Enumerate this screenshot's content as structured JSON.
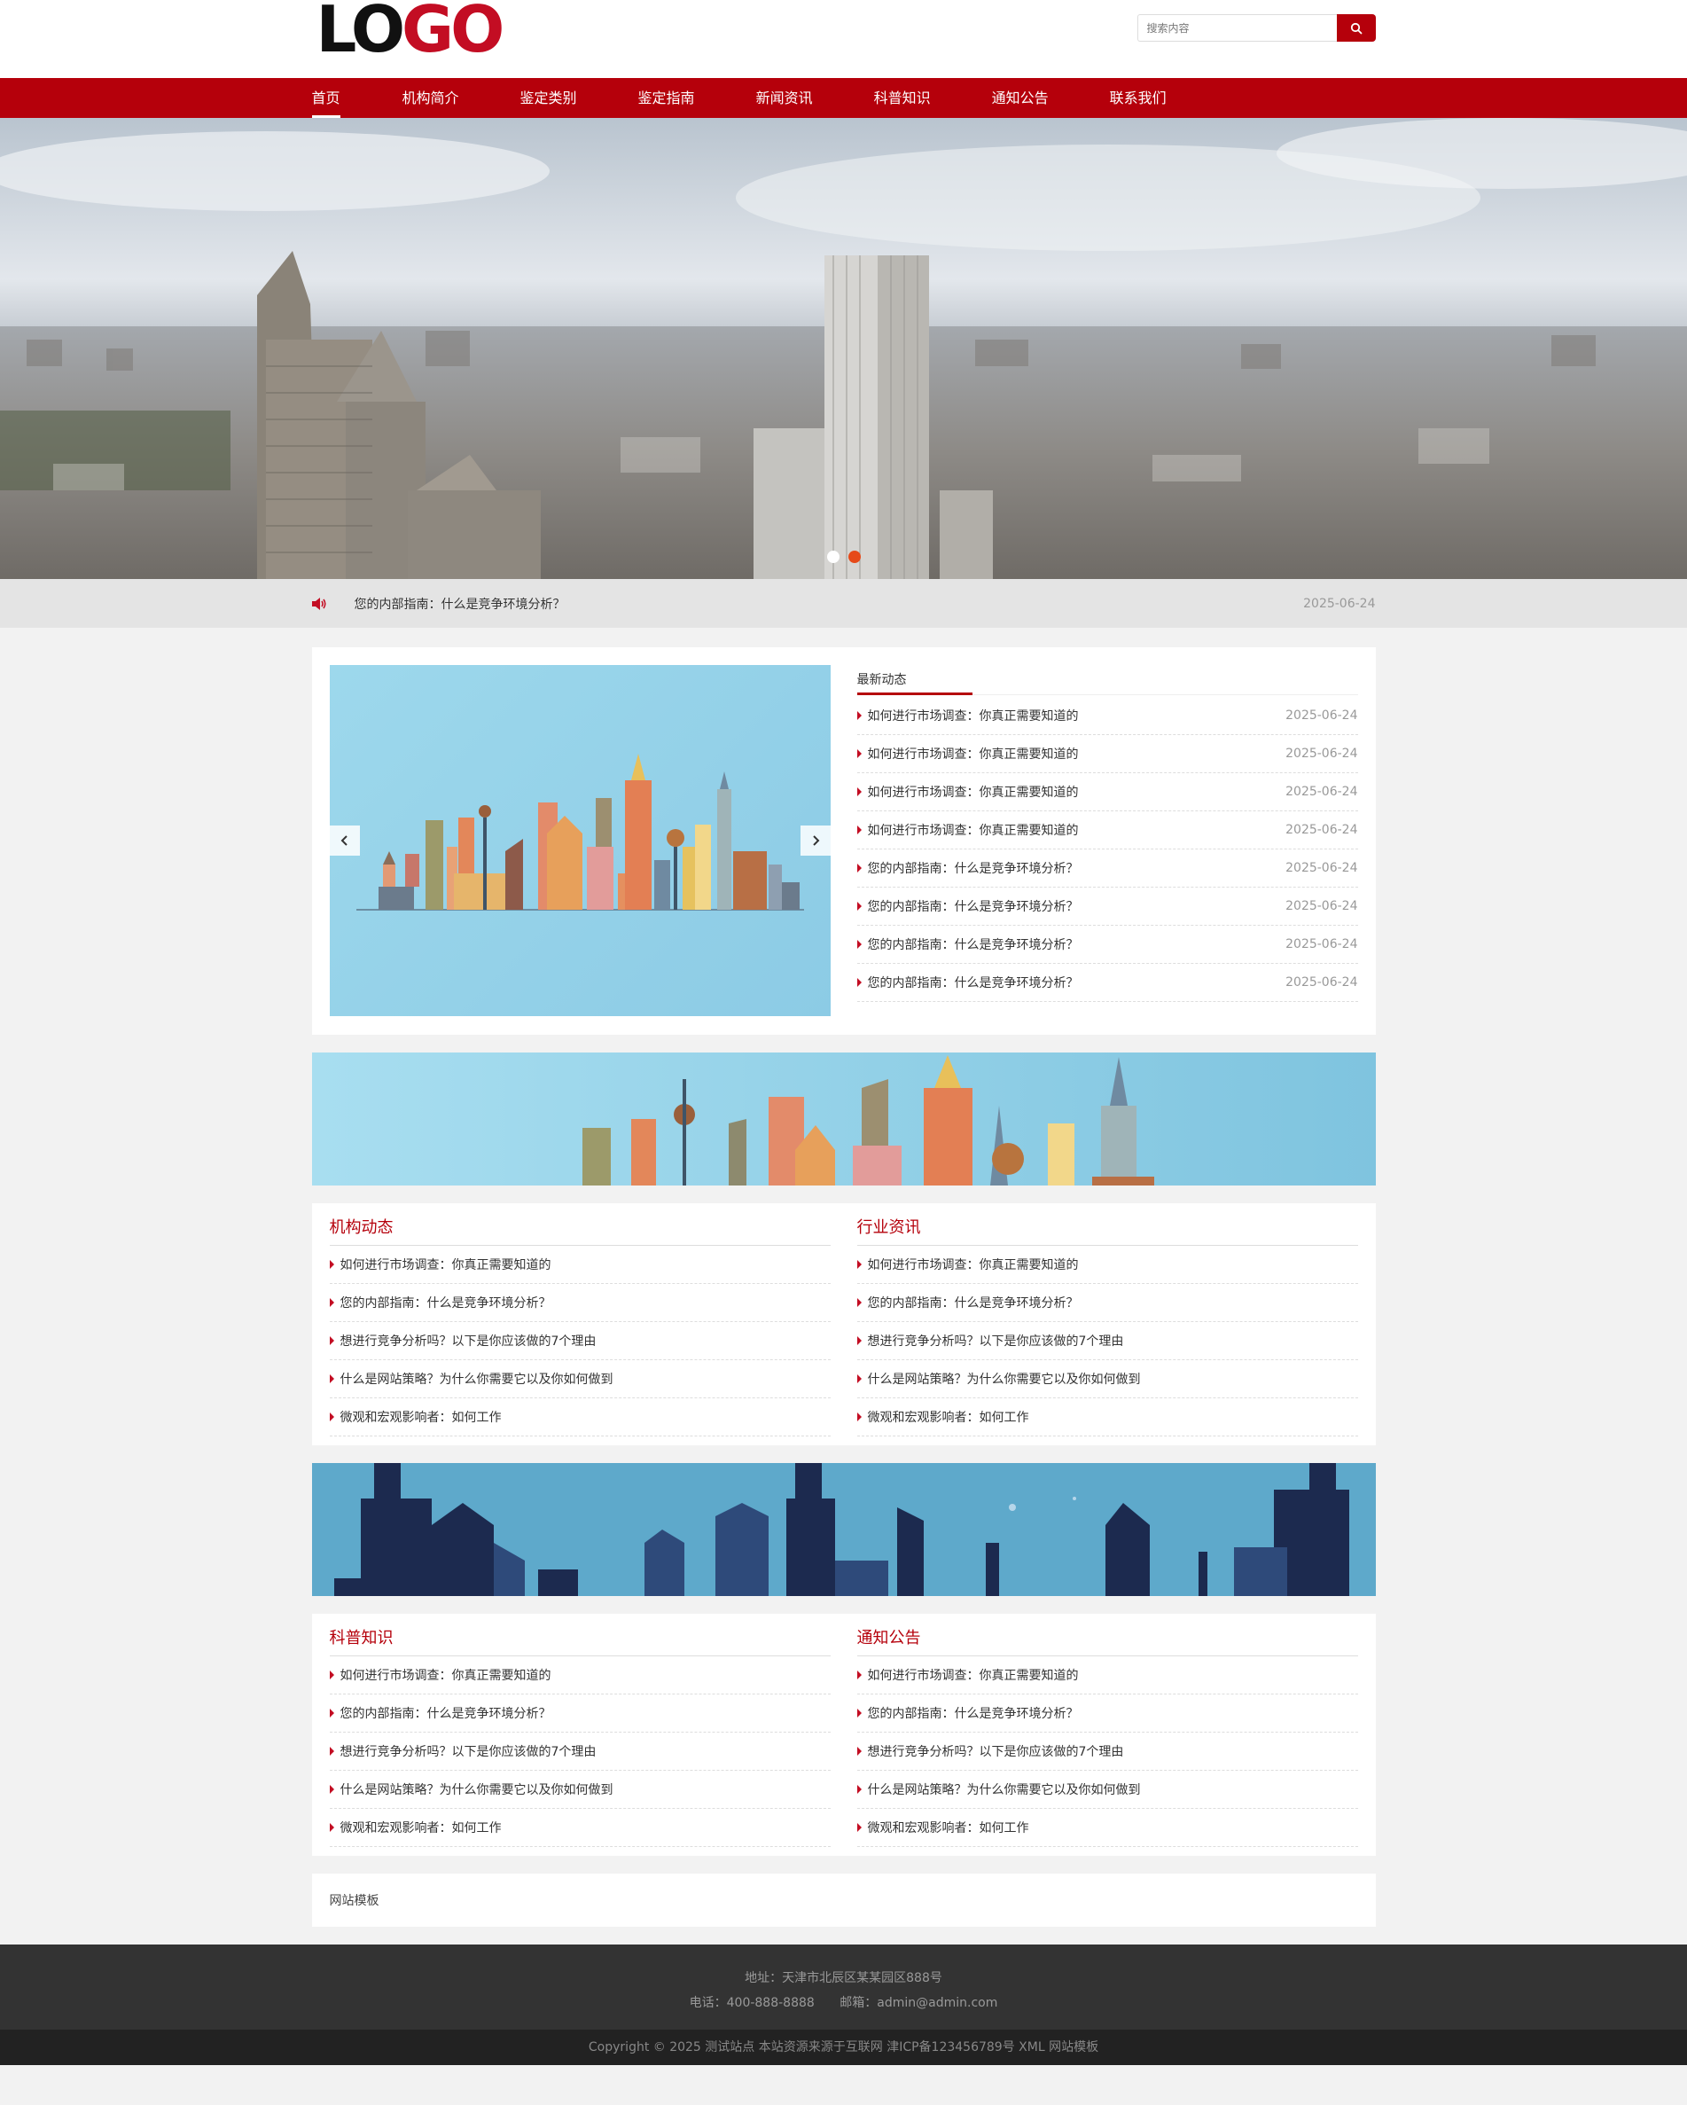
{
  "header": {
    "logo_text_left": "LO",
    "logo_text_right": "GO",
    "search_placeholder": "搜索内容",
    "search_icon": "search-icon"
  },
  "nav": {
    "items": [
      "首页",
      "机构简介",
      "鉴定类别",
      "鉴定指南",
      "新闻资讯",
      "科普知识",
      "通知公告",
      "联系我们"
    ],
    "active_index": 0
  },
  "banner": {
    "slide_count": 2,
    "active_slide": 1
  },
  "notice": {
    "icon": "speaker-icon",
    "text": "您的内部指南：什么是竞争环境分析？",
    "date": "2025-06-24"
  },
  "latest": {
    "title": "最新动态",
    "items": [
      {
        "title": "如何进行市场调查：你真正需要知道的",
        "date": "2025-06-24"
      },
      {
        "title": "如何进行市场调查：你真正需要知道的",
        "date": "2025-06-24"
      },
      {
        "title": "如何进行市场调查：你真正需要知道的",
        "date": "2025-06-24"
      },
      {
        "title": "如何进行市场调查：你真正需要知道的",
        "date": "2025-06-24"
      },
      {
        "title": "您的内部指南：什么是竞争环境分析？",
        "date": "2025-06-24"
      },
      {
        "title": "您的内部指南：什么是竞争环境分析？",
        "date": "2025-06-24"
      },
      {
        "title": "您的内部指南：什么是竞争环境分析？",
        "date": "2025-06-24"
      },
      {
        "title": "您的内部指南：什么是竞争环境分析？",
        "date": "2025-06-24"
      }
    ]
  },
  "sections": {
    "org_news": {
      "title": "机构动态",
      "items": [
        "如何进行市场调查：你真正需要知道的",
        "您的内部指南：什么是竞争环境分析？",
        "想进行竞争分析吗？以下是你应该做的7个理由",
        "什么是网站策略？为什么你需要它以及你如何做到",
        "微观和宏观影响者：如何工作"
      ]
    },
    "industry": {
      "title": "行业资讯",
      "items": [
        "如何进行市场调查：你真正需要知道的",
        "您的内部指南：什么是竞争环境分析？",
        "想进行竞争分析吗？以下是你应该做的7个理由",
        "什么是网站策略？为什么你需要它以及你如何做到",
        "微观和宏观影响者：如何工作"
      ]
    },
    "science": {
      "title": "科普知识",
      "items": [
        "如何进行市场调查：你真正需要知道的",
        "您的内部指南：什么是竞争环境分析？",
        "想进行竞争分析吗？以下是你应该做的7个理由",
        "什么是网站策略？为什么你需要它以及你如何做到",
        "微观和宏观影响者：如何工作"
      ]
    },
    "announce": {
      "title": "通知公告",
      "items": [
        "如何进行市场调查：你真正需要知道的",
        "您的内部指南：什么是竞争环境分析？",
        "想进行竞争分析吗？以下是你应该做的7个理由",
        "什么是网站策略？为什么你需要它以及你如何做到",
        "微观和宏观影响者：如何工作"
      ]
    }
  },
  "links": {
    "item": "网站模板"
  },
  "footer": {
    "address": "地址：天津市北辰区某某园区888号",
    "phone": "电话：400-888-8888",
    "email": "邮箱：admin@admin.com",
    "copyright": "Copyright © 2025 测试站点 本站资源来源于互联网 津ICP备123456789号 XML 网站模板"
  },
  "colors": {
    "brand_red": "#b5000b",
    "accent_red": "#c30d23",
    "footer_bg": "#333333"
  }
}
